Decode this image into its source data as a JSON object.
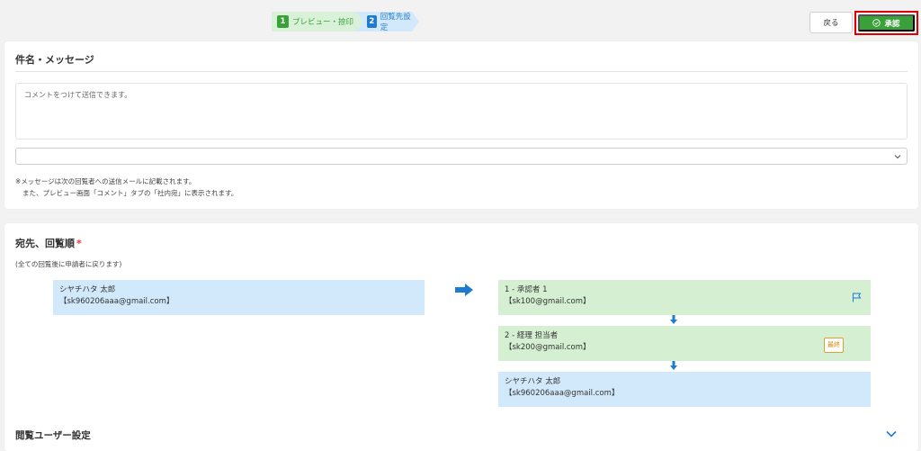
{
  "steps": [
    {
      "num": "1",
      "label": "プレビュー・捺印"
    },
    {
      "num": "2",
      "label": "回覧先設定"
    }
  ],
  "toolbar": {
    "back_label": "戻る",
    "approve_label": "承認"
  },
  "message_section": {
    "title": "件名・メッセージ",
    "placeholder": "コメントをつけて送信できます。",
    "select_value": "",
    "note_line1": "※メッセージは次の回覧者への送信メールに記載されます。",
    "note_line2": "また、プレビュー画面「コメント」タブの「社内宛」に表示されます。"
  },
  "route_section": {
    "title": "宛先、回覧順",
    "required_mark": "*",
    "note": "(全ての回覧後に申請者に戻ります)",
    "sender": {
      "name": "シヤチハタ 太郎",
      "email": "【sk960206aaa@gmail.com】"
    },
    "route": [
      {
        "label": "1 - 承認者 1",
        "email": "【sk100@gmail.com】"
      },
      {
        "label": "2 - 経理 担当者",
        "email": "【sk200@gmail.com】",
        "badge": "最終"
      },
      {
        "label": "シヤチハタ 太郎",
        "email": "【sk960206aaa@gmail.com】"
      }
    ]
  },
  "viewer_section": {
    "title": "閲覧ユーザー設定"
  },
  "colors": {
    "accent_green": "#3aa13a",
    "accent_blue": "#1f7ad1",
    "highlight_red": "#e00000"
  }
}
